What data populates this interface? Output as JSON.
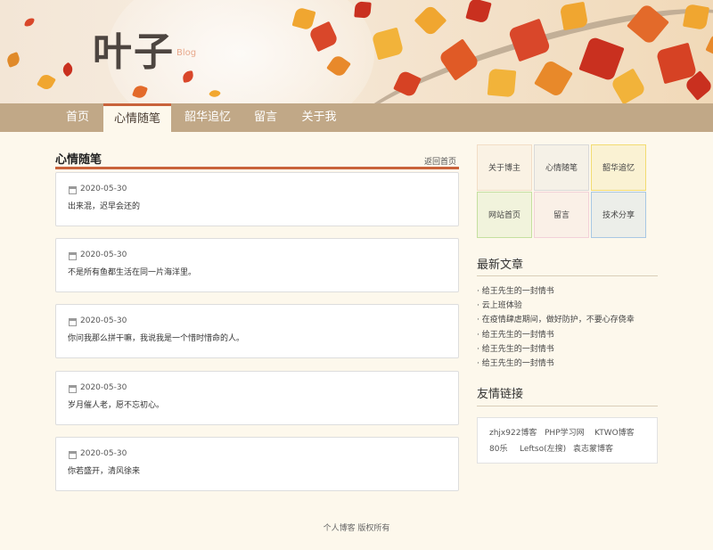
{
  "header": {
    "logo_text": "叶子",
    "logo_sub": "Blog"
  },
  "nav": {
    "items": [
      {
        "label": "首页"
      },
      {
        "label": "心情随笔"
      },
      {
        "label": "韶华追忆"
      },
      {
        "label": "留言"
      },
      {
        "label": "关于我"
      }
    ],
    "active_label": "心情随笔"
  },
  "main": {
    "title": "心情随笔",
    "back_link": "返回首页",
    "posts": [
      {
        "date": "2020-05-30",
        "text": "出来混，迟早会还的"
      },
      {
        "date": "2020-05-30",
        "text": "不是所有鱼都生活在同一片海洋里。"
      },
      {
        "date": "2020-05-30",
        "text": "你问我那么拼干嘛，我说我是一个惜时惜命的人。"
      },
      {
        "date": "2020-05-30",
        "text": "岁月催人老，愿不忘初心。"
      },
      {
        "date": "2020-05-30",
        "text": "你若盛开，清风徐来"
      }
    ]
  },
  "sidebar": {
    "tiles": [
      {
        "label": "关于博主",
        "color": "#f2ddc6"
      },
      {
        "label": "心情随笔",
        "color": "#d9d9d9"
      },
      {
        "label": "韶华追忆",
        "color": "#f2dc72"
      },
      {
        "label": "网站首页",
        "color": "#c4e09f"
      },
      {
        "label": "留言",
        "color": "#f2d1d8"
      },
      {
        "label": "技术分享",
        "color": "#a8c8e3"
      }
    ],
    "latest_title": "最新文章",
    "latest": [
      "· 给王先生的一封情书",
      "· 云上班体验",
      "· 在疫情肆虐期间，做好防护，不要心存侥幸",
      "· 给王先生的一封情书",
      "· 给王先生的一封情书",
      "· 给王先生的一封情书"
    ],
    "links_title": "友情链接",
    "links": [
      "zhjx922博客",
      "PHP学习网",
      "KTWO博客",
      "80乐",
      "Leftso(左搜)",
      "袁志蒙博客"
    ]
  },
  "footer": {
    "text": "个人博客 版权所有"
  }
}
